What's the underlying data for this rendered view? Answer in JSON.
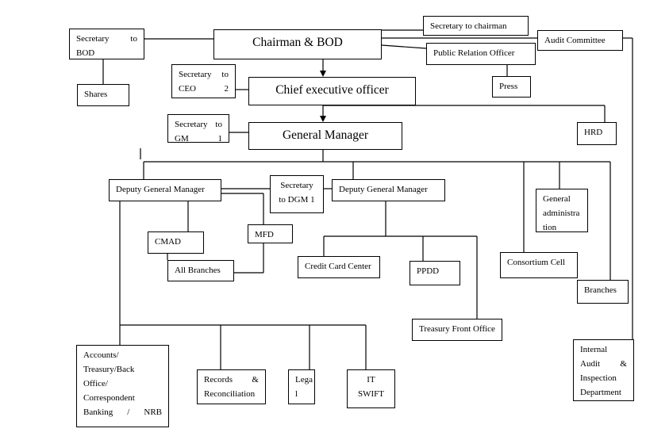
{
  "diagram": {
    "boxes": [
      {
        "id": "secretary-to-bod",
        "lines": [
          "Secretary to",
          "BOD"
        ],
        "style": "just"
      },
      {
        "id": "chairman-bod",
        "lines": [
          "Chairman & BOD"
        ],
        "style": "big"
      },
      {
        "id": "secretary-to-chairman",
        "lines": [
          "Secretary to chairman"
        ],
        "style": ""
      },
      {
        "id": "audit-committee",
        "lines": [
          "Audit Committee"
        ],
        "style": ""
      },
      {
        "id": "public-relation-officer",
        "lines": [
          "Public Relation Officer"
        ],
        "style": ""
      },
      {
        "id": "press",
        "lines": [
          "Press"
        ],
        "style": ""
      },
      {
        "id": "shares",
        "lines": [
          "Shares"
        ],
        "style": ""
      },
      {
        "id": "secretary-to-ceo",
        "lines": [
          "Secretary to",
          "CEO 2"
        ],
        "style": "just"
      },
      {
        "id": "chief-executive-officer",
        "lines": [
          "Chief executive officer"
        ],
        "style": "big"
      },
      {
        "id": "secretary-to-gm",
        "lines": [
          "Secretary to",
          "GM 1"
        ],
        "style": "just"
      },
      {
        "id": "general-manager",
        "lines": [
          "General Manager"
        ],
        "style": "big"
      },
      {
        "id": "hrd",
        "lines": [
          "HRD"
        ],
        "style": ""
      },
      {
        "id": "deputy-general-manager-left",
        "lines": [
          "Deputy General Manager"
        ],
        "style": ""
      },
      {
        "id": "secretary-to-dgm",
        "lines": [
          "Secretary",
          "to DGM 1"
        ],
        "style": "center"
      },
      {
        "id": "deputy-general-manager-right",
        "lines": [
          "Deputy General Manager"
        ],
        "style": ""
      },
      {
        "id": "general-administration",
        "lines": [
          "General",
          "administra",
          "tion"
        ],
        "style": ""
      },
      {
        "id": "cmad",
        "lines": [
          "CMAD"
        ],
        "style": ""
      },
      {
        "id": "mfd",
        "lines": [
          "MFD"
        ],
        "style": ""
      },
      {
        "id": "all-branches",
        "lines": [
          "All Branches"
        ],
        "style": ""
      },
      {
        "id": "credit-card-center",
        "lines": [
          "Credit Card Center"
        ],
        "style": ""
      },
      {
        "id": "ppdd",
        "lines": [
          "PPDD"
        ],
        "style": ""
      },
      {
        "id": "consortium-cell",
        "lines": [
          "Consortium Cell"
        ],
        "style": ""
      },
      {
        "id": "branches",
        "lines": [
          "Branches"
        ],
        "style": ""
      },
      {
        "id": "treasury-front-office",
        "lines": [
          "Treasury Front Office"
        ],
        "style": ""
      },
      {
        "id": "accounts-treasury-back-office",
        "lines": [
          "Accounts/",
          "Treasury/Back",
          "Office/",
          "Correspondent",
          "Banking / NRB"
        ],
        "style": "just"
      },
      {
        "id": "records-reconciliation",
        "lines": [
          "Records &",
          "Reconciliation"
        ],
        "style": "just"
      },
      {
        "id": "legal",
        "lines": [
          "Lega",
          "l"
        ],
        "style": ""
      },
      {
        "id": "it-swift",
        "lines": [
          "IT",
          "SWIFT"
        ],
        "style": "center"
      },
      {
        "id": "internal-audit-inspection",
        "lines": [
          "Internal",
          "Audit &",
          "Inspection",
          "Department"
        ],
        "style": "just"
      }
    ]
  }
}
